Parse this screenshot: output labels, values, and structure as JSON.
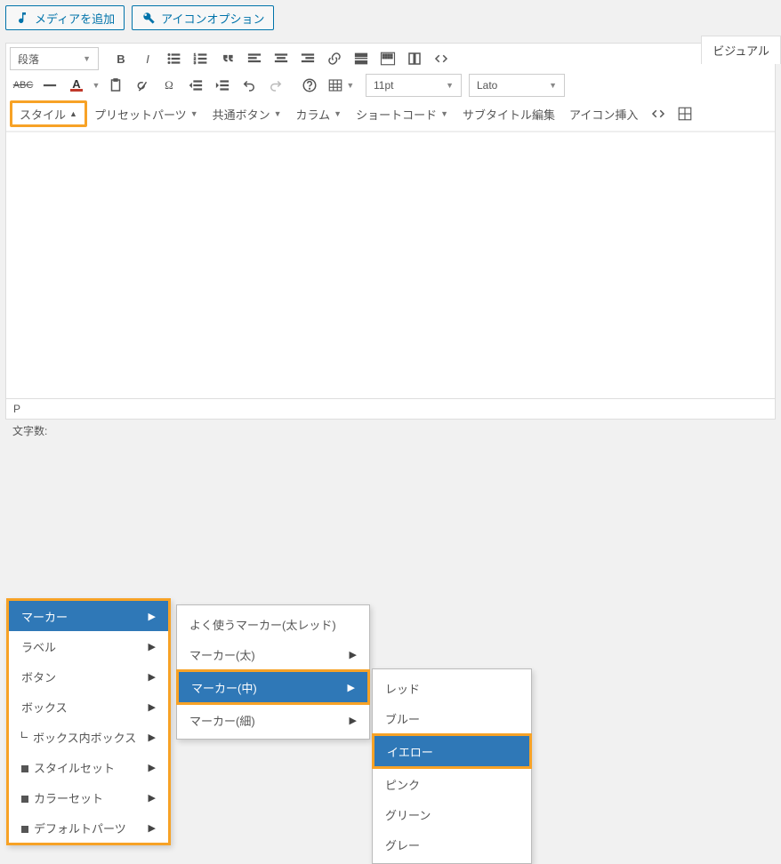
{
  "top_buttons": {
    "media": "メディアを追加",
    "icon_opts": "アイコンオプション"
  },
  "tab": {
    "visual": "ビジュアル"
  },
  "format_select": "段落",
  "row2": {
    "font_size": "11pt",
    "font_family": "Lato"
  },
  "row3": {
    "style": "スタイル",
    "preset": "プリセットパーツ",
    "common_btn": "共通ボタン",
    "column": "カラム",
    "shortcode": "ショートコード",
    "subtitle": "サブタイトル編集",
    "icon_insert": "アイコン挿入"
  },
  "menu1": {
    "items": [
      {
        "label": "マーカー",
        "sub": true
      },
      {
        "label": "ラベル",
        "sub": true
      },
      {
        "label": "ボタン",
        "sub": true
      },
      {
        "label": "ボックス",
        "sub": true
      },
      {
        "label": "ボックス内ボックス",
        "sub": true,
        "indent": true
      },
      {
        "label": "スタイルセット",
        "sub": true,
        "bullet": true
      },
      {
        "label": "カラーセット",
        "sub": true,
        "bullet": true
      },
      {
        "label": "デフォルトパーツ",
        "sub": true,
        "bullet": true
      }
    ]
  },
  "menu2": {
    "items": [
      {
        "label": "よく使うマーカー(太レッド)"
      },
      {
        "label": "マーカー(太)",
        "sub": true
      },
      {
        "label": "マーカー(中)",
        "sub": true,
        "selected": true
      },
      {
        "label": "マーカー(細)",
        "sub": true
      }
    ]
  },
  "menu3": {
    "items": [
      {
        "label": "レッド"
      },
      {
        "label": "ブルー"
      },
      {
        "label": "イエロー",
        "selected": true
      },
      {
        "label": "ピンク"
      },
      {
        "label": "グリーン"
      },
      {
        "label": "グレー"
      }
    ]
  },
  "status": {
    "path": "P",
    "charcount_label": "文字数:"
  }
}
